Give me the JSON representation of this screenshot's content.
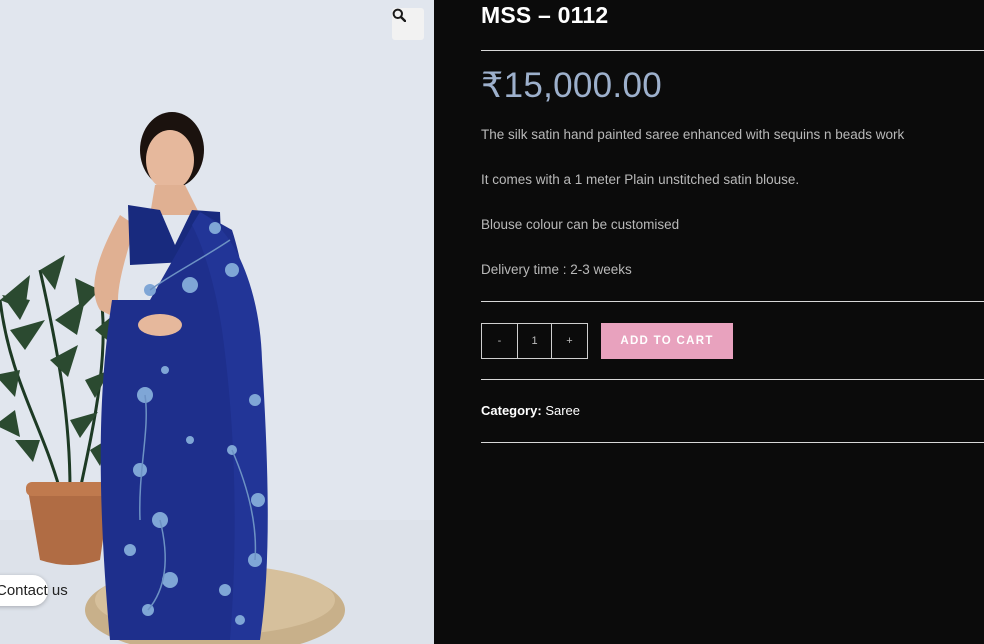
{
  "product": {
    "title": "MSS – 0112",
    "price": "₹15,000.00",
    "description": [
      "The silk satin hand painted saree enhanced with sequins n beads work",
      "It comes with a 1 meter Plain unstitched satin blouse.",
      "Blouse colour can be customised",
      "Delivery time : 2-3 weeks"
    ],
    "quantity": {
      "minus_label": "-",
      "value": "1",
      "plus_label": "+"
    },
    "add_to_cart_label": "ADD TO CART",
    "meta": {
      "category_label": "Category:",
      "category_value": "Saree"
    }
  },
  "gallery": {
    "zoom_icon": "magnifier-icon"
  },
  "contact": {
    "label": "Contact us"
  },
  "colors": {
    "page_background": "#0b0b0b",
    "price": "#9db0cc",
    "add_to_cart": "#e8a2be",
    "saree": "#1e2f8c"
  }
}
